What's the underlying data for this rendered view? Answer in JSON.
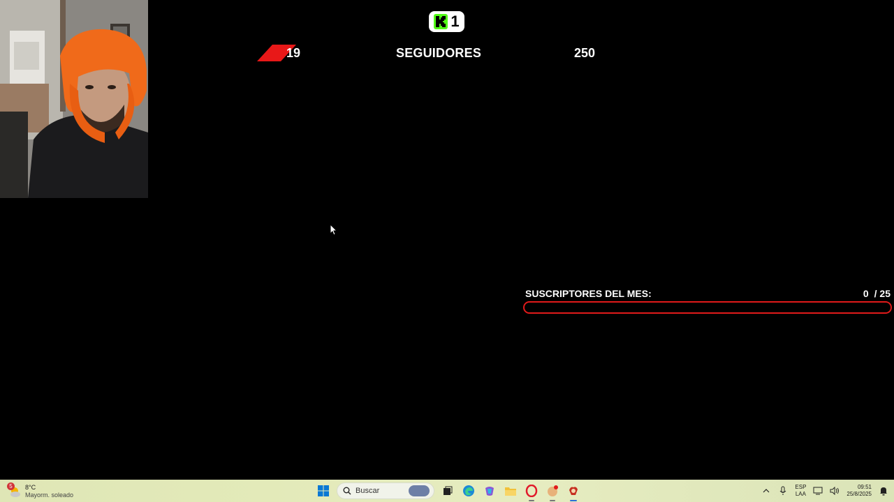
{
  "overlay": {
    "kick_viewers": "1",
    "followers": {
      "current": "19",
      "label": "SEGUIDORES",
      "goal": "250"
    },
    "subs": {
      "label": "SUSCRIPTORES DEL MES:",
      "current": "0",
      "goal": "/ 25",
      "progress_fraction": 0
    }
  },
  "taskbar": {
    "weather": {
      "badge": "5",
      "temp": "8°C",
      "desc": "Mayorm. soleado",
      "icon": "sun-cloud-icon"
    },
    "search_placeholder": "Buscar",
    "apps": [
      "start-icon",
      "search-icon",
      "task-view-icon",
      "edge-icon",
      "copilot-icon",
      "file-explorer-icon",
      "opera-icon",
      "app-icon",
      "obs-icon"
    ],
    "language": {
      "line1": "ESP",
      "line2": "LAA"
    },
    "clock": {
      "time": "09:51",
      "date": "25/8/2025"
    }
  },
  "colors": {
    "kick_green": "#53fc18",
    "goal_red": "#e11a1a",
    "background": "#000000"
  }
}
